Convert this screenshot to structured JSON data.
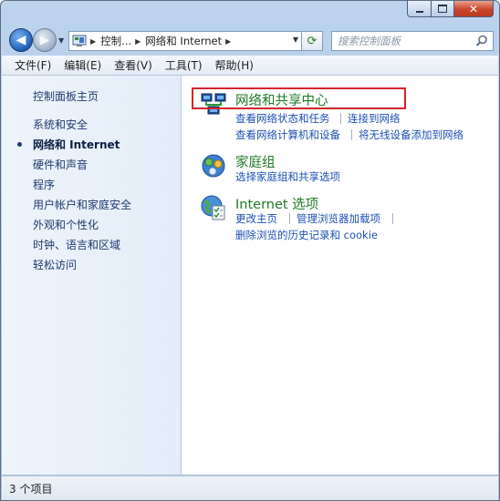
{
  "window": {
    "caption_buttons": [
      "minimize",
      "maximize",
      "close"
    ]
  },
  "address": {
    "crumbs": [
      "控制...",
      "网络和 Internet"
    ],
    "search_placeholder": "搜索控制面板"
  },
  "menu": {
    "items": [
      "文件(F)",
      "编辑(E)",
      "查看(V)",
      "工具(T)",
      "帮助(H)"
    ]
  },
  "sidebar": {
    "items": [
      {
        "label": "控制面板主页",
        "current": false
      },
      {
        "label": "系统和安全",
        "current": false
      },
      {
        "label": "网络和 Internet",
        "current": true
      },
      {
        "label": "硬件和声音",
        "current": false
      },
      {
        "label": "程序",
        "current": false
      },
      {
        "label": "用户帐户和家庭安全",
        "current": false
      },
      {
        "label": "外观和个性化",
        "current": false
      },
      {
        "label": "时钟、语言和区域",
        "current": false
      },
      {
        "label": "轻松访问",
        "current": false
      }
    ]
  },
  "main": {
    "categories": [
      {
        "title": "网络和共享中心",
        "icon": "network-sharing-icon",
        "tasks": [
          "查看网络状态和任务",
          "连接到网络",
          "查看网络计算机和设备",
          "将无线设备添加到网络"
        ]
      },
      {
        "title": "家庭组",
        "icon": "homegroup-icon",
        "tasks": [
          "选择家庭组和共享选项"
        ]
      },
      {
        "title": "Internet 选项",
        "icon": "internet-options-icon",
        "tasks": [
          "更改主页",
          "管理浏览器加载项",
          "删除浏览的历史记录和 cookie"
        ]
      }
    ]
  },
  "status": {
    "text": "3 个项目"
  },
  "colors": {
    "category_title": "#1e7a23",
    "task_link": "#1b4fb4",
    "highlight": "#d6232a"
  }
}
